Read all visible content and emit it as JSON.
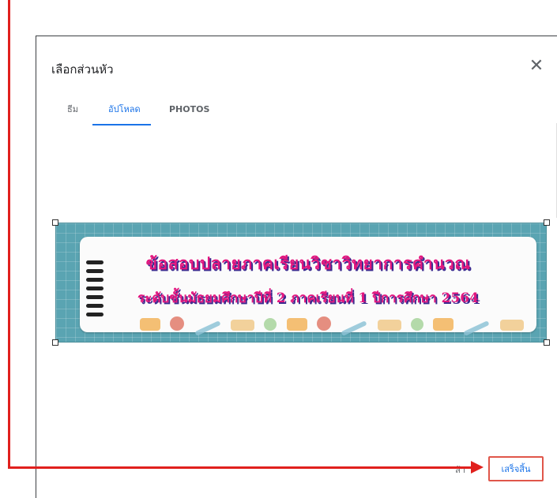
{
  "dialog": {
    "title": "เลือกส่วนหัว",
    "close_icon": "close-icon"
  },
  "tabs": [
    {
      "label": "ธีม",
      "active": false
    },
    {
      "label": "อัปโหลด",
      "active": true
    },
    {
      "label": "PHOTOS",
      "active": false
    }
  ],
  "banner": {
    "line1": "ข้อสอบปลายภาคเรียนวิชาวิทยาการคำนวณ",
    "line2": "ระดับชั้นมัธยมศึกษาปีที่ 2 ภาคเรียนที่ 1 ปีการศึกษา 2564"
  },
  "footer": {
    "cancel_partial": "ล้า",
    "done_label": "เสร็จสิ้น"
  },
  "colors": {
    "accent": "#1a73e8",
    "annotation_red": "#e0201d",
    "banner_bg": "#5aa4b2",
    "title_pink": "#e2177f"
  }
}
